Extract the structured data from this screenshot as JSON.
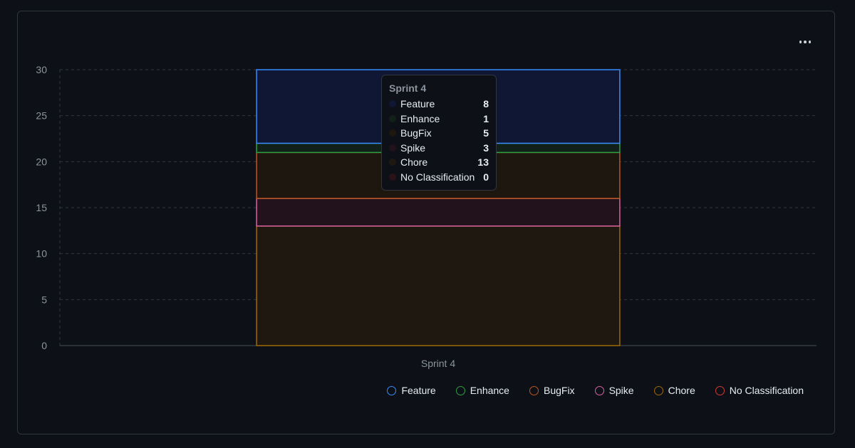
{
  "chart_data": {
    "type": "bar",
    "stacked": true,
    "categories": [
      "Sprint 4"
    ],
    "yticks": [
      0,
      5,
      10,
      15,
      20,
      25,
      30
    ],
    "ylim": [
      0,
      30
    ],
    "grid": true,
    "legend_position": "bottom-right",
    "series": [
      {
        "name": "Chore",
        "values": [
          13
        ],
        "color": "#9e6a03",
        "fill": "#1f1810"
      },
      {
        "name": "Spike",
        "values": [
          3
        ],
        "color": "#db61a2",
        "fill": "#22121b"
      },
      {
        "name": "BugFix",
        "values": [
          5
        ],
        "color": "#bd561d",
        "fill": "#1e1710"
      },
      {
        "name": "Enhance",
        "values": [
          1
        ],
        "color": "#2ea043",
        "fill": "#12201a"
      },
      {
        "name": "Feature",
        "values": [
          8
        ],
        "color": "#388bfd",
        "fill": "#0f1734"
      },
      {
        "name": "No Classification",
        "values": [
          0
        ],
        "color": "#da3633",
        "fill": "#2a1216"
      }
    ]
  },
  "tooltip": {
    "title": "Sprint 4",
    "rows": [
      {
        "label": "Feature",
        "value": "8",
        "color": "#0f1734"
      },
      {
        "label": "Enhance",
        "value": "1",
        "color": "#12201a"
      },
      {
        "label": "BugFix",
        "value": "5",
        "color": "#1e1710"
      },
      {
        "label": "Spike",
        "value": "3",
        "color": "#22121b"
      },
      {
        "label": "Chore",
        "value": "13",
        "color": "#1f1810"
      },
      {
        "label": "No Classification",
        "value": "0",
        "color": "#2a1216"
      }
    ]
  },
  "legend": [
    {
      "label": "Feature",
      "color": "#388bfd"
    },
    {
      "label": "Enhance",
      "color": "#2ea043"
    },
    {
      "label": "BugFix",
      "color": "#bd561d"
    },
    {
      "label": "Spike",
      "color": "#db61a2"
    },
    {
      "label": "Chore",
      "color": "#9e6a03"
    },
    {
      "label": "No Classification",
      "color": "#da3633"
    }
  ],
  "menu": {
    "icon": "kebab-horizontal-icon"
  }
}
